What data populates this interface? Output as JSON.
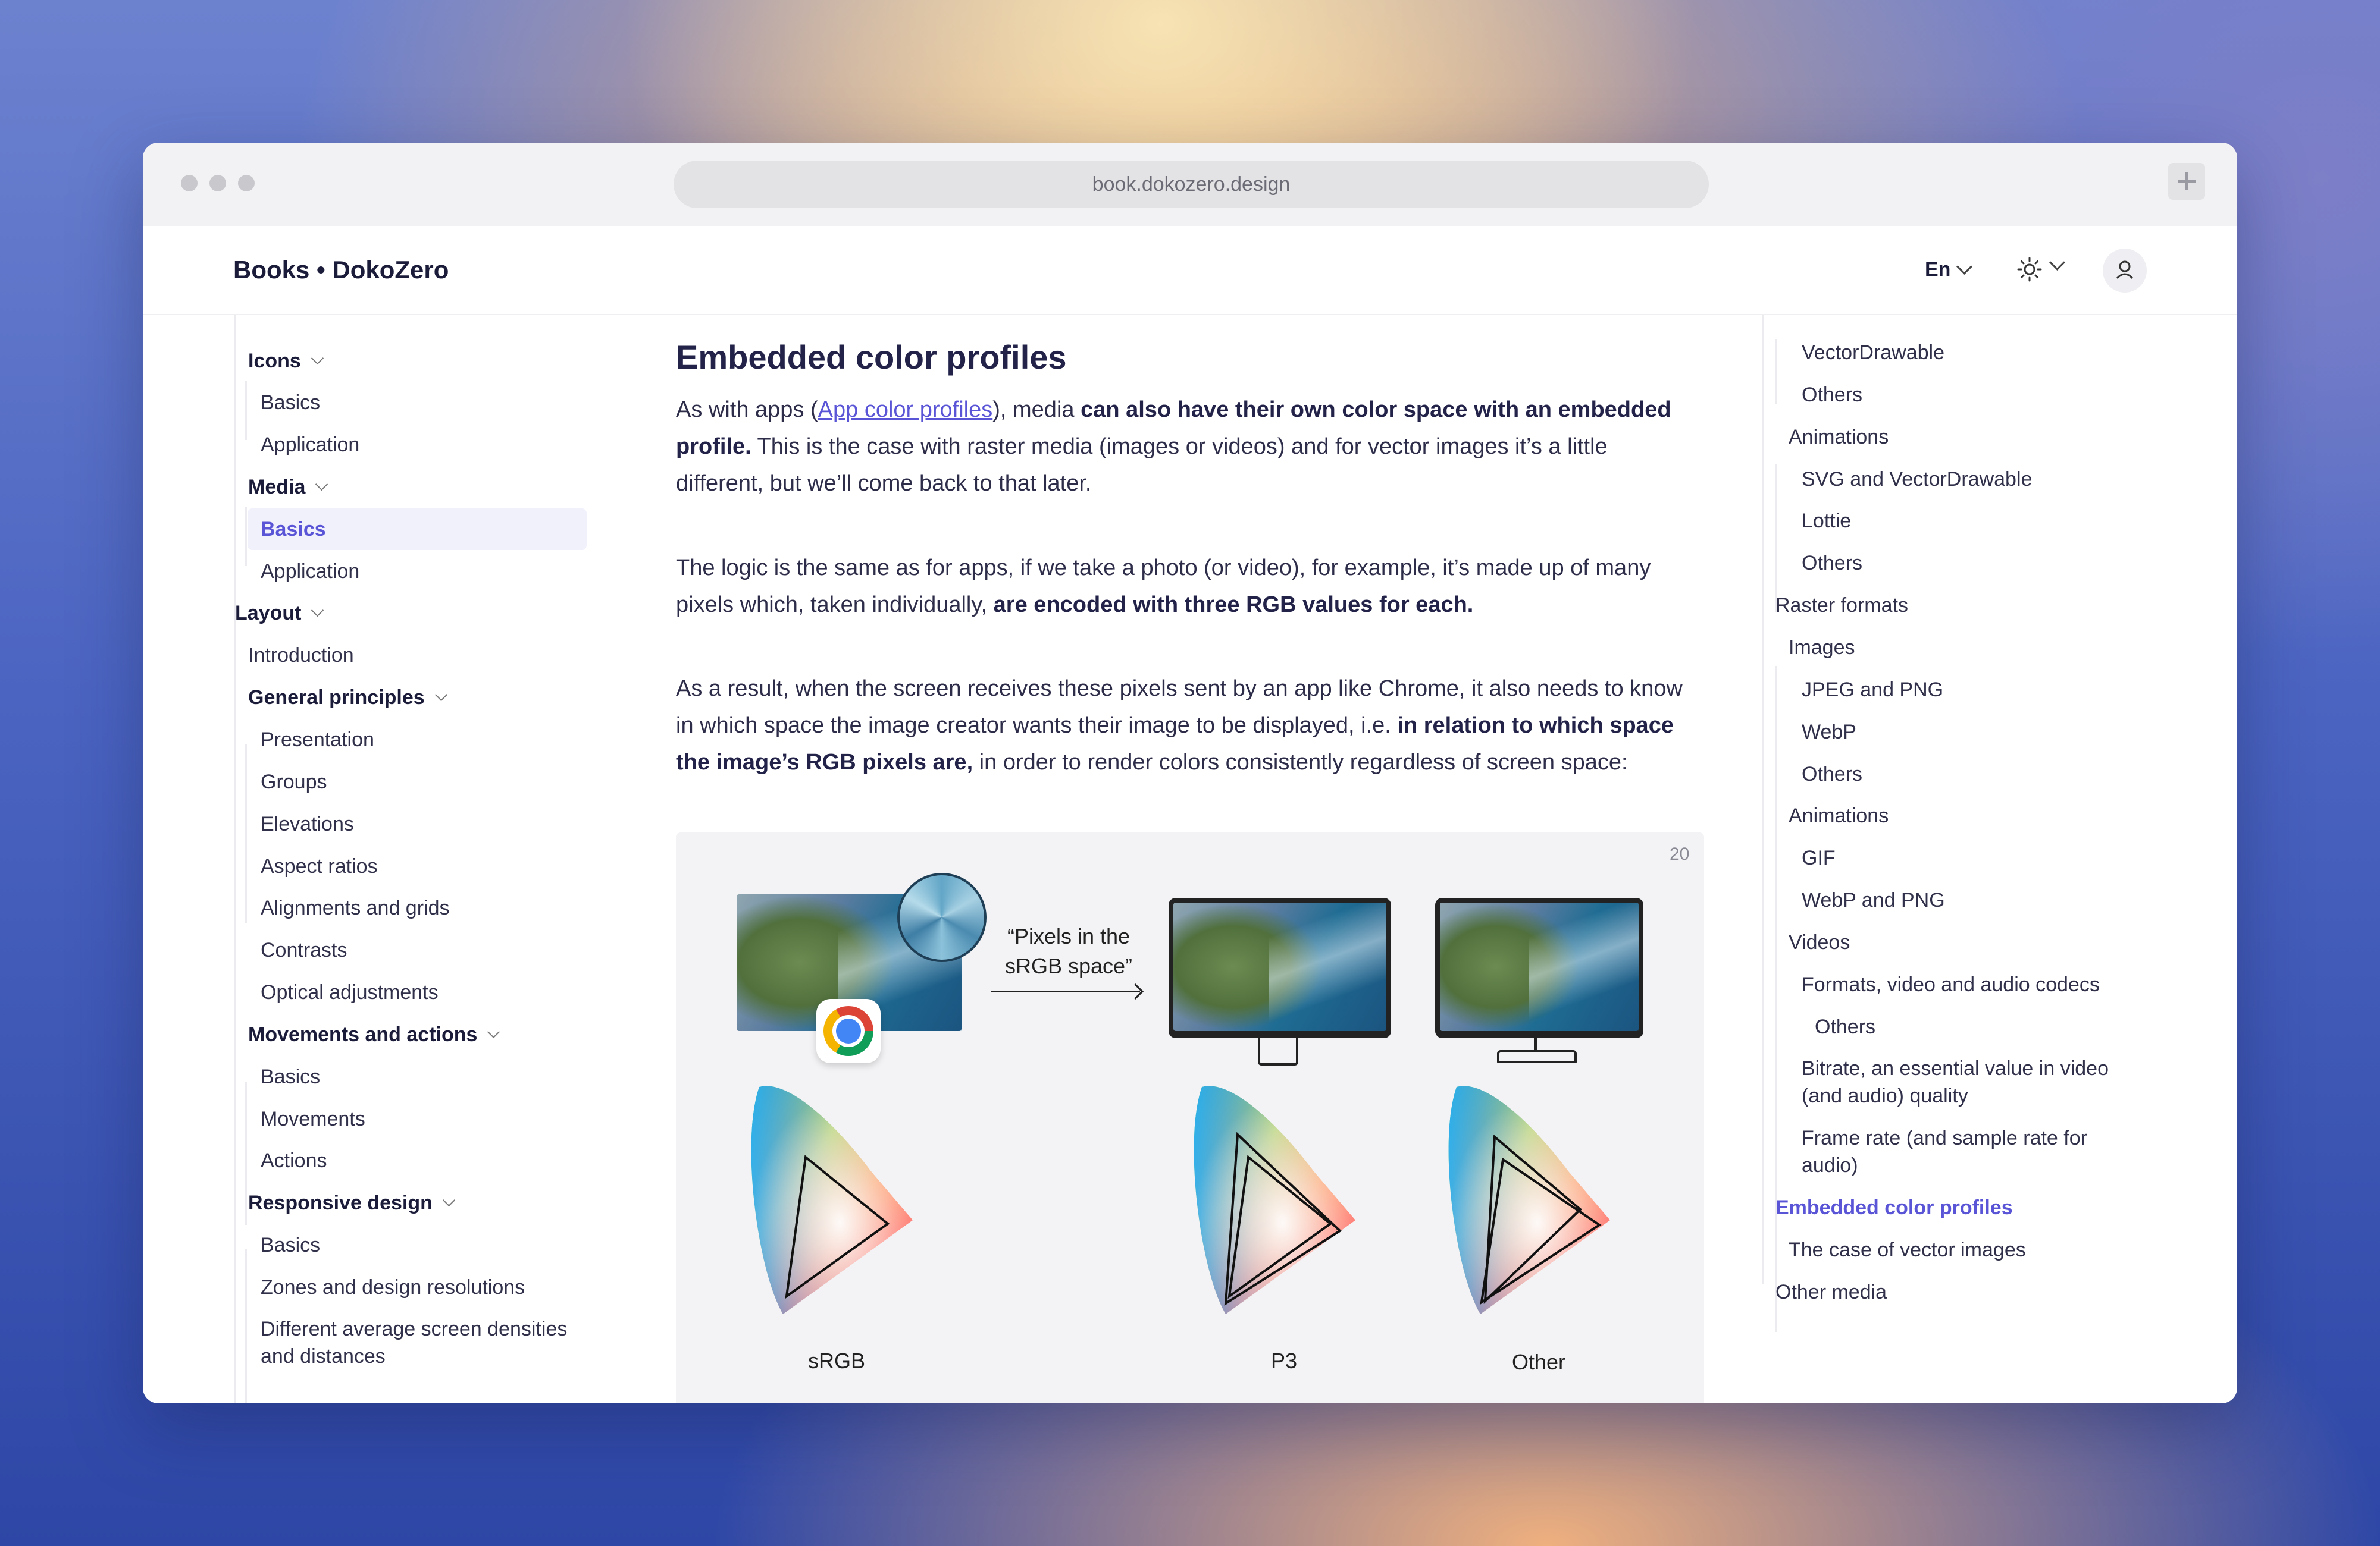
{
  "browser": {
    "url": "book.dokozero.design"
  },
  "header": {
    "brand": "Books • DokoZero",
    "language": "En"
  },
  "left_nav": {
    "items": [
      {
        "label": "Icons",
        "type": "section"
      },
      {
        "label": "Basics",
        "type": "sub"
      },
      {
        "label": "Application",
        "type": "sub"
      },
      {
        "label": "Media",
        "type": "section"
      },
      {
        "label": "Basics",
        "type": "sub",
        "active": true
      },
      {
        "label": "Application",
        "type": "sub"
      },
      {
        "label": "Layout",
        "type": "top"
      },
      {
        "label": "Introduction",
        "type": "item"
      },
      {
        "label": "General principles",
        "type": "section"
      },
      {
        "label": "Presentation",
        "type": "sub"
      },
      {
        "label": "Groups",
        "type": "sub"
      },
      {
        "label": "Elevations",
        "type": "sub"
      },
      {
        "label": "Aspect ratios",
        "type": "sub"
      },
      {
        "label": "Alignments and grids",
        "type": "sub"
      },
      {
        "label": "Contrasts",
        "type": "sub"
      },
      {
        "label": "Optical adjustments",
        "type": "sub"
      },
      {
        "label": "Movements and actions",
        "type": "section"
      },
      {
        "label": "Basics",
        "type": "sub"
      },
      {
        "label": "Movements",
        "type": "sub"
      },
      {
        "label": "Actions",
        "type": "sub"
      },
      {
        "label": "Responsive design",
        "type": "section"
      },
      {
        "label": "Basics",
        "type": "sub"
      },
      {
        "label": "Zones and design resolutions",
        "type": "sub"
      },
      {
        "label": "Different average screen densities",
        "type": "sub"
      },
      {
        "label": "and distances",
        "type": "sub"
      }
    ]
  },
  "article": {
    "title": "Embedded color profiles",
    "p1": {
      "pre": "As with apps (",
      "link": "App color profiles",
      "mid": "), media ",
      "bold": "can also have their own color space with an embedded profile.",
      "post": " This is the case with raster media (images or videos) and for vector images it’s a little different, but we’ll come back to that later."
    },
    "p2": {
      "pre": "The logic is the same as for apps, if we take a photo (or video), for example, it’s made up of many pixels which, taken individually, ",
      "bold": "are encoded with three RGB values for each."
    },
    "p3": {
      "pre": "As a result, when the screen receives these pixels sent by an app like Chrome, it also needs to know in which space the image creator wants their image to be displayed, i.e. ",
      "bold": "in relation to which space the image’s RGB pixels are,",
      "post": " in order to render colors consistently regardless of screen space:"
    },
    "figure": {
      "number": "20",
      "caption_line1": "“Pixels in the",
      "caption_line2": "sRGB space”",
      "labels": [
        "sRGB",
        "P3",
        "Other"
      ]
    }
  },
  "toc": {
    "items": [
      {
        "label": "VectorDrawable",
        "level": 3
      },
      {
        "label": "Others",
        "level": 3
      },
      {
        "label": "Animations",
        "level": 2
      },
      {
        "label": "SVG and VectorDrawable",
        "level": 3
      },
      {
        "label": "Lottie",
        "level": 3
      },
      {
        "label": "Others",
        "level": 3
      },
      {
        "label": "Raster formats",
        "level": 1
      },
      {
        "label": "Images",
        "level": 2
      },
      {
        "label": "JPEG and PNG",
        "level": 3
      },
      {
        "label": "WebP",
        "level": 3
      },
      {
        "label": "Others",
        "level": 3
      },
      {
        "label": "Animations",
        "level": 2
      },
      {
        "label": "GIF",
        "level": 3
      },
      {
        "label": "WebP and PNG",
        "level": 3
      },
      {
        "label": "Videos",
        "level": 2
      },
      {
        "label": "Formats, video and audio codecs",
        "level": 3
      },
      {
        "label": "Others",
        "level": 4
      },
      {
        "label": "Bitrate, an essential value in video",
        "level": 3
      },
      {
        "label": "(and audio) quality",
        "level": 3
      },
      {
        "label": "Frame rate (and sample rate for",
        "level": 3
      },
      {
        "label": "audio)",
        "level": 3
      },
      {
        "label": "Embedded color profiles",
        "level": 1,
        "active": true
      },
      {
        "label": "The case of vector images",
        "level": 2
      },
      {
        "label": "Other media",
        "level": 1
      }
    ]
  },
  "colors": {
    "accent": "#5a55d6",
    "text": "#23234a",
    "figure_bg": "#f3f3f5"
  }
}
